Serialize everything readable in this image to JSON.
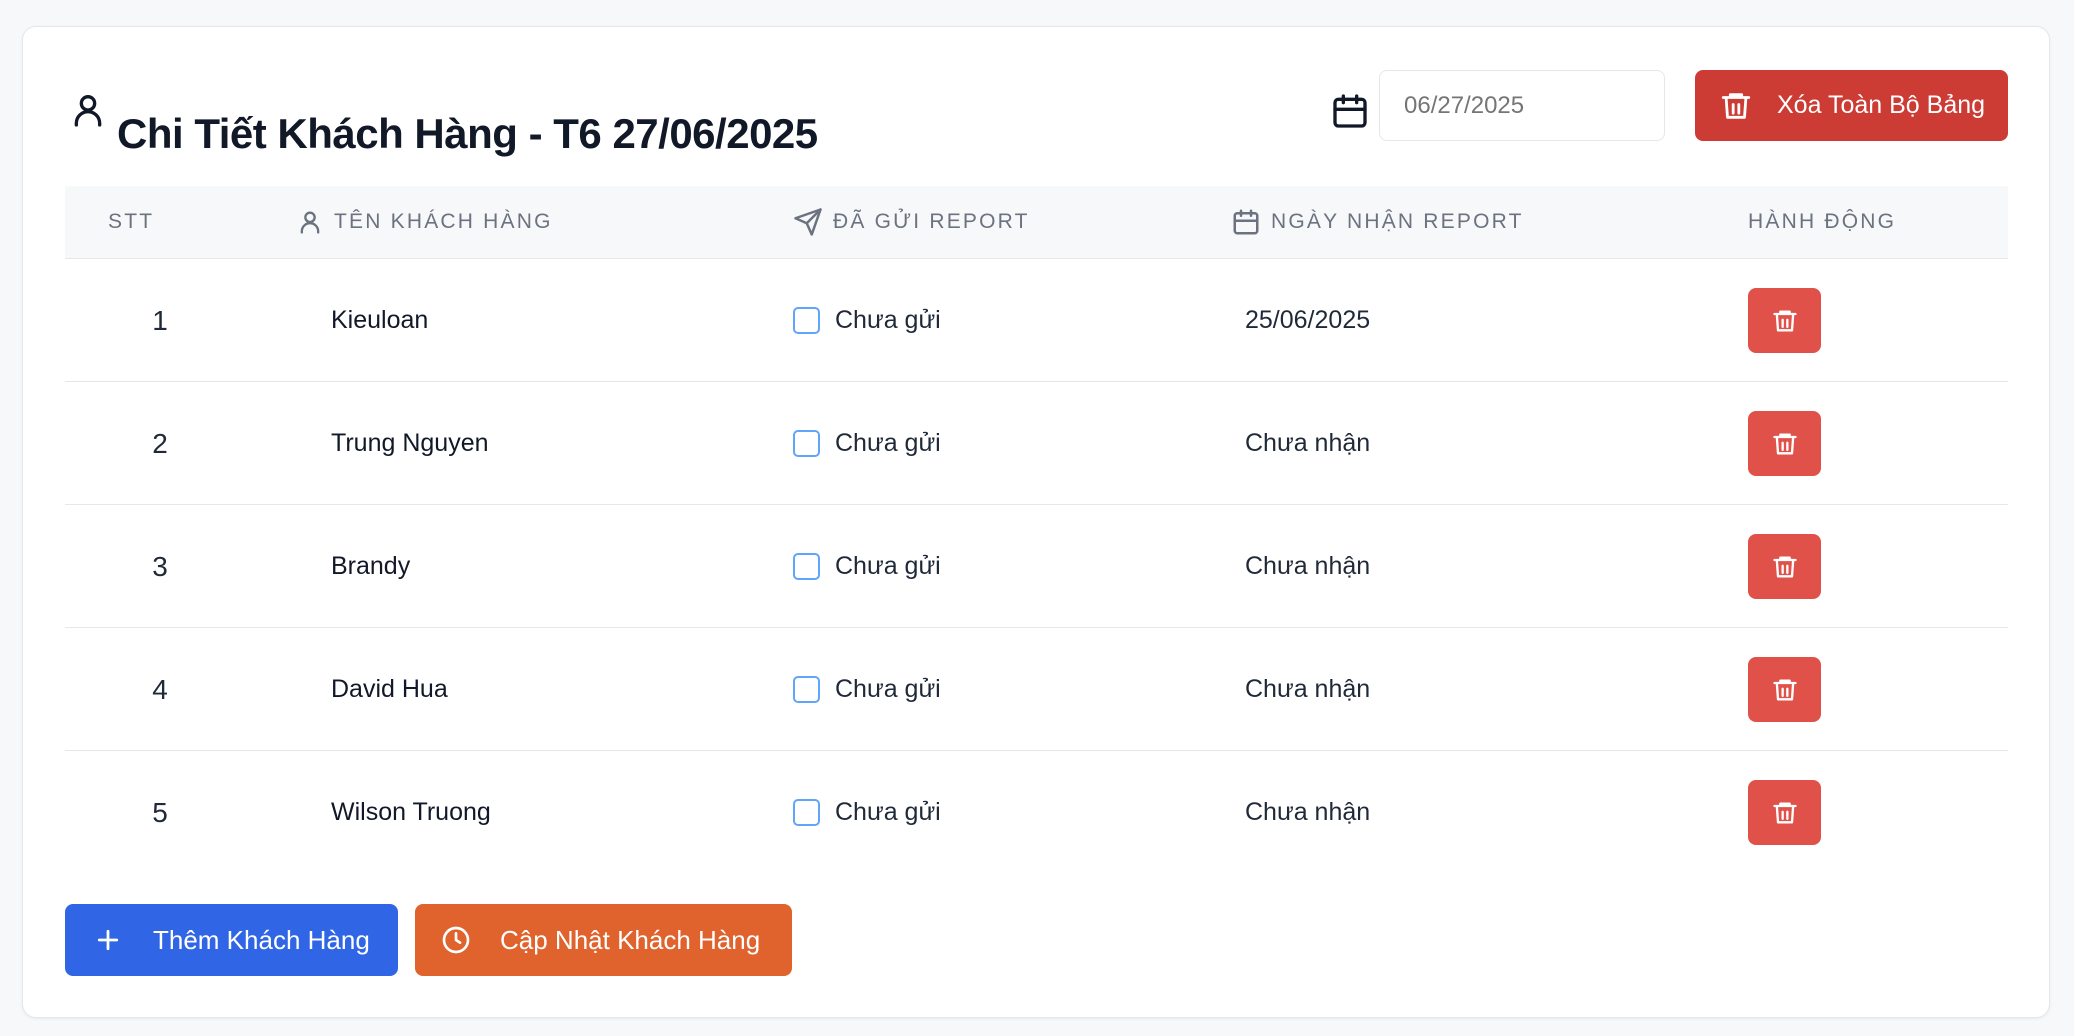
{
  "header": {
    "title": "Chi Tiết Khách Hàng - T6 27/06/2025",
    "date_placeholder": "06/27/2025",
    "clear_all_label": "Xóa Toàn Bộ Bảng"
  },
  "table": {
    "columns": {
      "index": "STT",
      "customer_name": "TÊN KHÁCH HÀNG",
      "report_sent": "ĐÃ GỬI REPORT",
      "report_received_date": "NGÀY NHẬN REPORT",
      "actions": "HÀNH ĐỘNG"
    },
    "rows": [
      {
        "index": "1",
        "name": "Kieuloan",
        "sent_checked": false,
        "sent_label": "Chưa gửi",
        "received": "25/06/2025"
      },
      {
        "index": "2",
        "name": "Trung Nguyen",
        "sent_checked": false,
        "sent_label": "Chưa gửi",
        "received": "Chưa nhận"
      },
      {
        "index": "3",
        "name": "Brandy",
        "sent_checked": false,
        "sent_label": "Chưa gửi",
        "received": "Chưa nhận"
      },
      {
        "index": "4",
        "name": "David Hua",
        "sent_checked": false,
        "sent_label": "Chưa gửi",
        "received": "Chưa nhận"
      },
      {
        "index": "5",
        "name": "Wilson Truong",
        "sent_checked": false,
        "sent_label": "Chưa gửi",
        "received": "Chưa nhận"
      }
    ]
  },
  "footer": {
    "add_label": "Thêm Khách Hàng",
    "update_label": "Cập Nhật Khách Hàng"
  },
  "icons": {
    "title": "user-icon",
    "date": "calendar-icon",
    "clear_all": "trash-icon",
    "col_name": "user-icon",
    "col_sent": "send-icon",
    "col_date": "calendar-icon",
    "row_delete": "trash-icon",
    "add": "plus-icon",
    "update": "clock-icon"
  },
  "colors": {
    "danger_dark": "#cc3b34",
    "danger": "#e05149",
    "primary": "#3066e6",
    "warning": "#e0622c",
    "checkbox_border": "#60a5fa"
  }
}
